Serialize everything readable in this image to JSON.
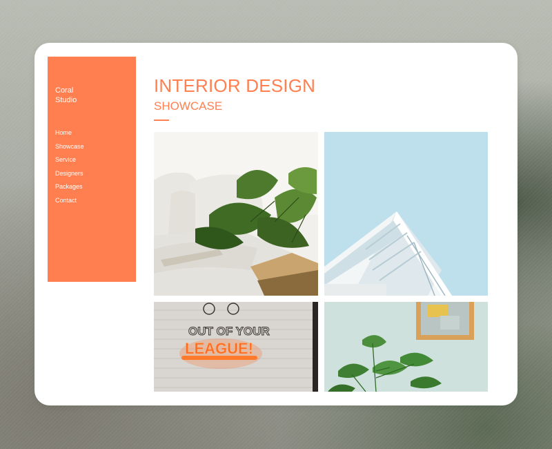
{
  "brand": {
    "name": "Coral\nStudio"
  },
  "nav": {
    "items": [
      "Home",
      "Showcase",
      "Service",
      "Designers",
      "Packages",
      "Contact"
    ]
  },
  "header": {
    "title": "INTERIOR DESIGN",
    "subtitle": "SHOWCASE"
  },
  "gallery": {
    "tiles": [
      {
        "subject": "bedroom with monstera plant"
      },
      {
        "subject": "modern building against blue sky"
      },
      {
        "subject": "neon sign on brick wall",
        "sign_text": "OUT OF YOUR\nLEAGUE!"
      },
      {
        "subject": "plant and framed art on wall"
      }
    ]
  },
  "colors": {
    "accent": "#ff7f50",
    "sidebar_text": "#ffffff"
  }
}
